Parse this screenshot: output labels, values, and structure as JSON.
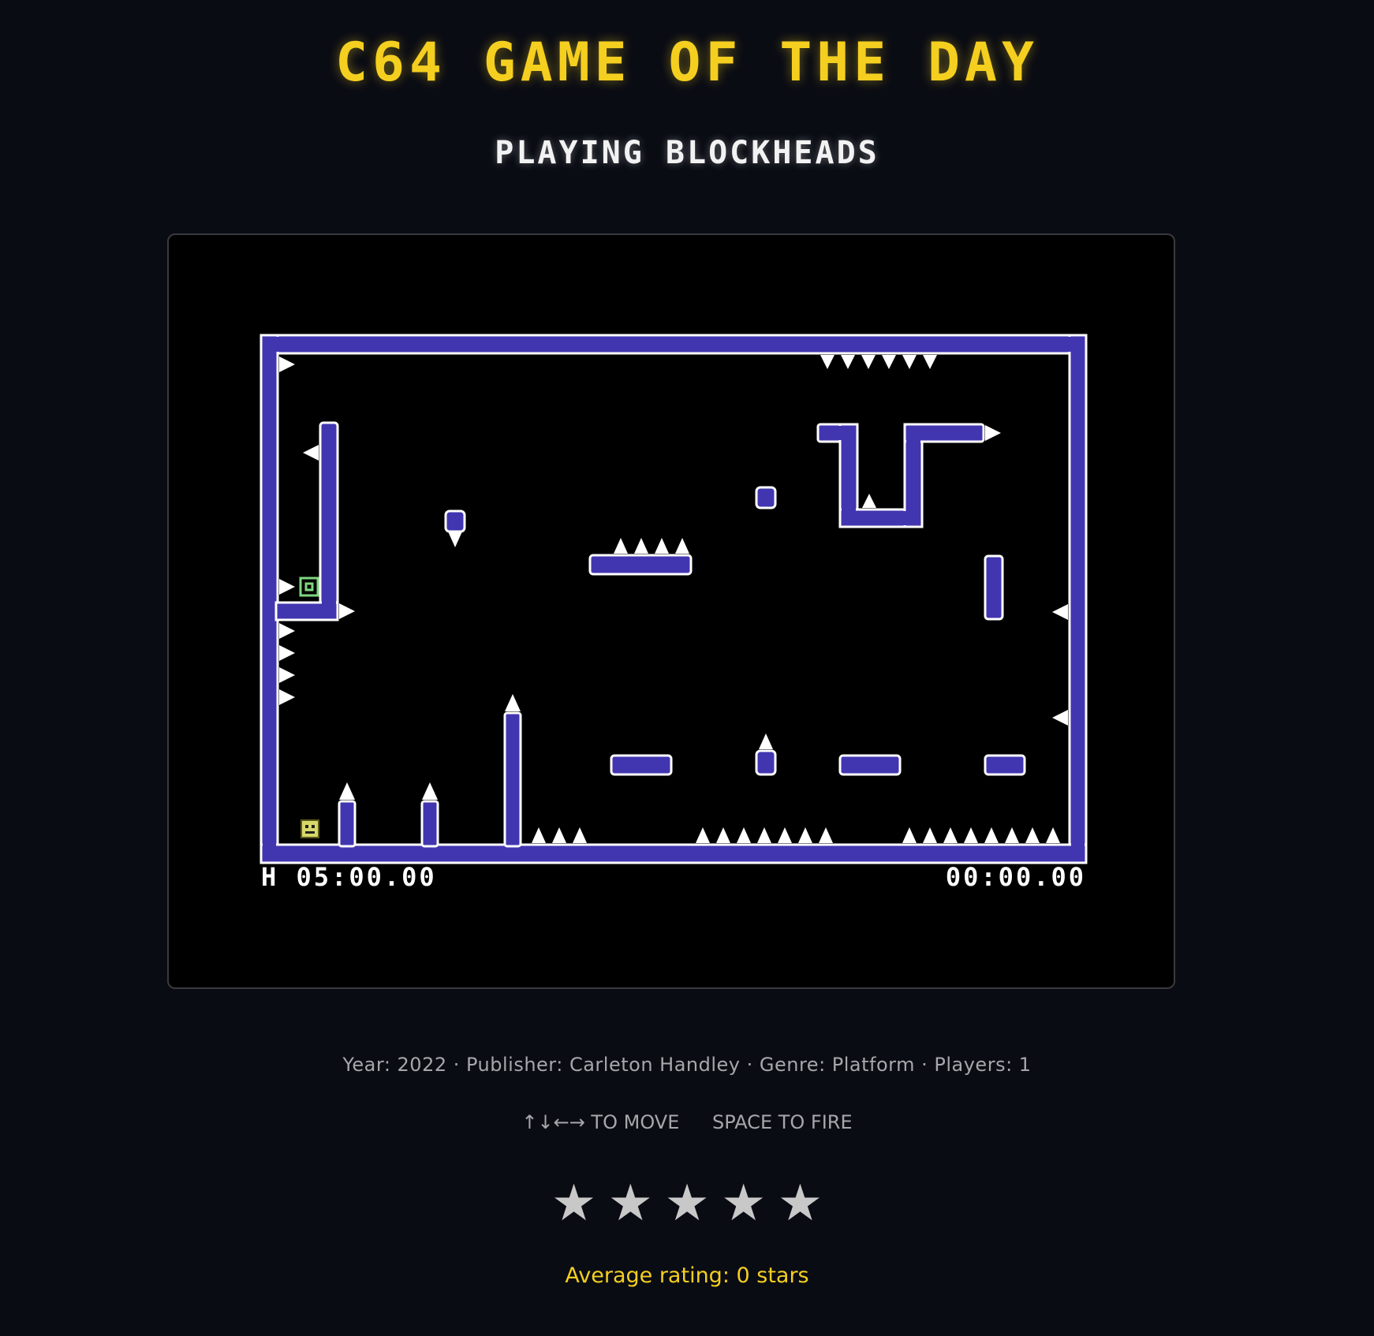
{
  "header": {
    "title": "C64 GAME OF THE DAY",
    "subtitle": "PLAYING BLOCKHEADS"
  },
  "game": {
    "hud_left": "H 05:00.00",
    "hud_right": "00:00.00",
    "colors": {
      "wall": "#4236b0",
      "outline": "#ffffff",
      "background": "#000000",
      "exit_block": "#7fd67f",
      "player": "#d8d86a"
    }
  },
  "info": {
    "meta_line": "Year: 2022 · Publisher: Carleton Handley · Genre: Platform · Players: 1",
    "control_move": "↑↓←→ TO MOVE",
    "control_fire": "SPACE TO FIRE"
  },
  "rating": {
    "stars": [
      "★",
      "★",
      "★",
      "★",
      "★"
    ],
    "average_label": "Average rating: 0 stars",
    "average_value": 0
  }
}
